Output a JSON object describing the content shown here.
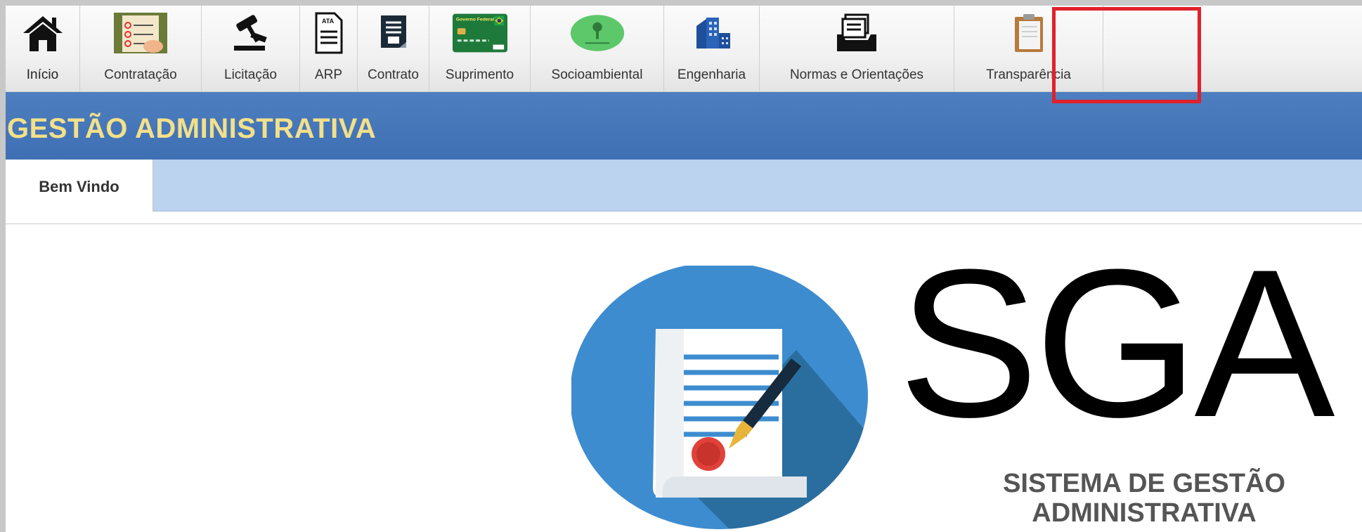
{
  "menu": {
    "items": [
      {
        "label": "Início",
        "icon": "home-icon"
      },
      {
        "label": "Contratação",
        "icon": "contract-hiring-icon"
      },
      {
        "label": "Licitação",
        "icon": "gavel-icon"
      },
      {
        "label": "ARP",
        "icon": "ata-document-icon",
        "icon_text": "ATA"
      },
      {
        "label": "Contrato",
        "icon": "contract-icon"
      },
      {
        "label": "Suprimento",
        "icon": "card-icon",
        "icon_text": "Governo Federal"
      },
      {
        "label": "Socioambiental",
        "icon": "tree-icon"
      },
      {
        "label": "Engenharia",
        "icon": "buildings-icon"
      },
      {
        "label": "Normas e Orientações",
        "icon": "file-tray-icon"
      },
      {
        "label": "Transparência",
        "icon": "clipboard-icon"
      }
    ],
    "highlighted": "Transparência"
  },
  "title": "GESTÃO ADMINISTRATIVA",
  "tabs": [
    {
      "label": "Bem Vindo"
    }
  ],
  "logo": {
    "letters": "SGA",
    "subtitle_line1": "SISTEMA DE GESTÃO",
    "subtitle_line2": "ADMINISTRATIVA"
  },
  "colors": {
    "title_bar": "#4d7fc0",
    "title_text": "#f3e08a",
    "tab_strip": "#bcd3ef",
    "highlight": "#e0212b"
  }
}
